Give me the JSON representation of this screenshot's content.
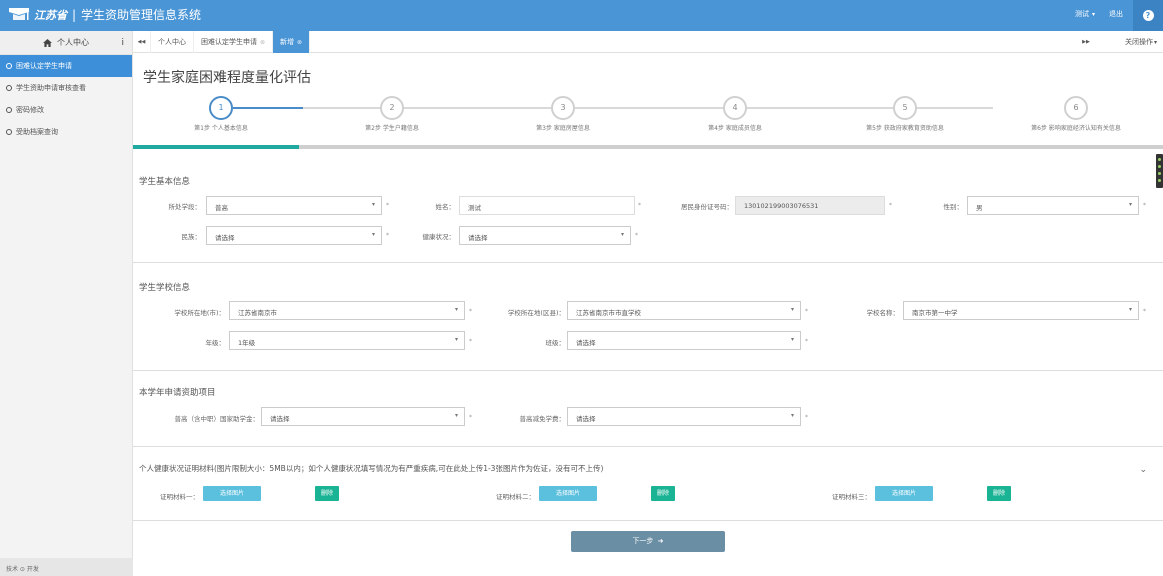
{
  "header": {
    "logo_text": "江苏省",
    "separator": "|",
    "system_title": "学生资助管理信息系统",
    "user": "测试",
    "logout": "退出"
  },
  "sidebar": {
    "title": "个人中心",
    "toggle": "i",
    "items": [
      {
        "label": "困难认定学生申请",
        "active": true
      },
      {
        "label": "学生资助申请审核查看",
        "active": false
      },
      {
        "label": "密码修改",
        "active": false
      },
      {
        "label": "受助档案查询",
        "active": false
      }
    ],
    "footer": "技术 ⊙ 开发"
  },
  "tabs": {
    "prev": "◀◀",
    "next": "▶▶",
    "items": [
      {
        "label": "个人中心"
      },
      {
        "label": "困难认定学生申请"
      },
      {
        "label": "新增"
      }
    ],
    "close_ops": "关闭操作"
  },
  "page": {
    "title": "学生家庭困难程度量化评估"
  },
  "steps": [
    {
      "num": "1",
      "label": "第1步 个人基本信息"
    },
    {
      "num": "2",
      "label": "第2步 学生户籍信息"
    },
    {
      "num": "3",
      "label": "第3步 家庭房屋信息"
    },
    {
      "num": "4",
      "label": "第4步 家庭成员信息"
    },
    {
      "num": "5",
      "label": "第5步 获政府家教育资助信息"
    },
    {
      "num": "6",
      "label": "第6步 影响家庭经济认知有关信息"
    }
  ],
  "basic": {
    "title": "学生基本信息",
    "stage_label": "所处学段：",
    "stage_value": "普高",
    "name_label": "姓名：",
    "name_value": "测试",
    "id_label": "居民身份证号码：",
    "id_value": "130102199003076531",
    "gender_label": "性别：",
    "gender_value": "男",
    "ethnic_label": "民族：",
    "ethnic_value": "请选择",
    "health_label": "健康状况：",
    "health_value": "请选择"
  },
  "school": {
    "title": "学生学校信息",
    "city_label": "学校所在地(市)：",
    "city_value": "江苏省南京市",
    "district_label": "学校所在地(区县)：",
    "district_value": "江苏省南京市市直学校",
    "name_label": "学校名称：",
    "name_value": "南京市第一中学",
    "grade_label": "年级：",
    "grade_value": "1年级",
    "class_label": "班级：",
    "class_value": "请选择"
  },
  "aid": {
    "title": "本学年申请资助项目",
    "grant_label": "普高（含中职）国家助学金：",
    "grant_value": "请选择",
    "waiver_label": "普高减免学费：",
    "waiver_value": "请选择"
  },
  "proof": {
    "title": "个人健康状况证明材料(图片限制大小：5MB以内；如个人健康状况填写情况为有严重疾病,可在此处上传1-3张图片作为佐证，没有可不上传)",
    "items": [
      {
        "label": "证明材料一：",
        "pick": "选择图片",
        "del": "删除"
      },
      {
        "label": "证明材料二：",
        "pick": "选择图片",
        "del": "删除"
      },
      {
        "label": "证明材料三：",
        "pick": "选择图片",
        "del": "删除"
      }
    ]
  },
  "next_button": "下一步"
}
